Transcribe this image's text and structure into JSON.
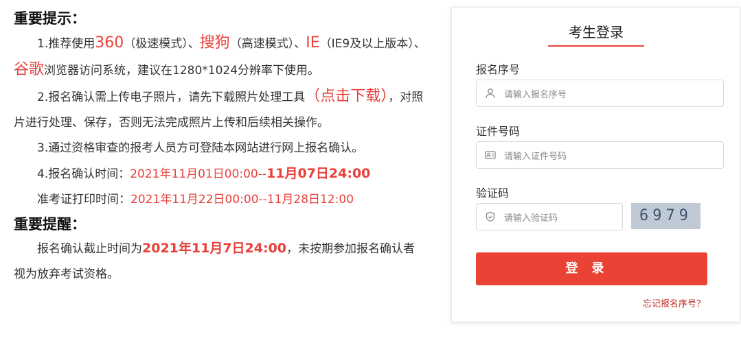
{
  "notice": {
    "heading1": "重要提示：",
    "p1": {
      "a": "1.推荐使用",
      "b": "360",
      "c": "（极速模式）、",
      "d": "搜狗",
      "e": "（高速模式）、",
      "f": "IE",
      "g": "（IE9及以上版本）、",
      "h": "谷歌",
      "i": "浏览器访问系统，建议在1280*1024分辨率下使用。"
    },
    "p2": {
      "a": "2.报名确认需上传电子照片，请先下载照片处理工具",
      "b": "（点击下载）",
      "c": "，对照片进行处理、保存，否则无法完成照片上传和后续相关操作。"
    },
    "p3": "3.通过资格审查的报考人员方可登陆本网站进行网上报名确认。",
    "p4": {
      "a": "4.报名确认时间：",
      "b": "2021年11月01日00:00--",
      "c": "11月07日24:00"
    },
    "p5": {
      "a": "准考证打印时间：",
      "b": "2021年11月22日00:00--11月28日12:00"
    },
    "heading2": "重要提醒：",
    "p6": {
      "a": "报名确认截止时间为",
      "b": "2021年11月7日24:00",
      "c": "，未按期参加报名确认者视为放弃考试资格。"
    }
  },
  "login": {
    "title": "考生登录",
    "accent_color": "#e8403b",
    "field1": {
      "label": "报名序号",
      "placeholder": "请输入报名序号",
      "icon": "user-icon"
    },
    "field2": {
      "label": "证件号码",
      "placeholder": "请输入证件号码",
      "icon": "id-card-icon"
    },
    "field3": {
      "label": "验证码",
      "placeholder": "请输入验证码",
      "icon": "shield-icon"
    },
    "captcha": "6979",
    "submit": "登录",
    "forgot": "忘记报名序号？"
  }
}
